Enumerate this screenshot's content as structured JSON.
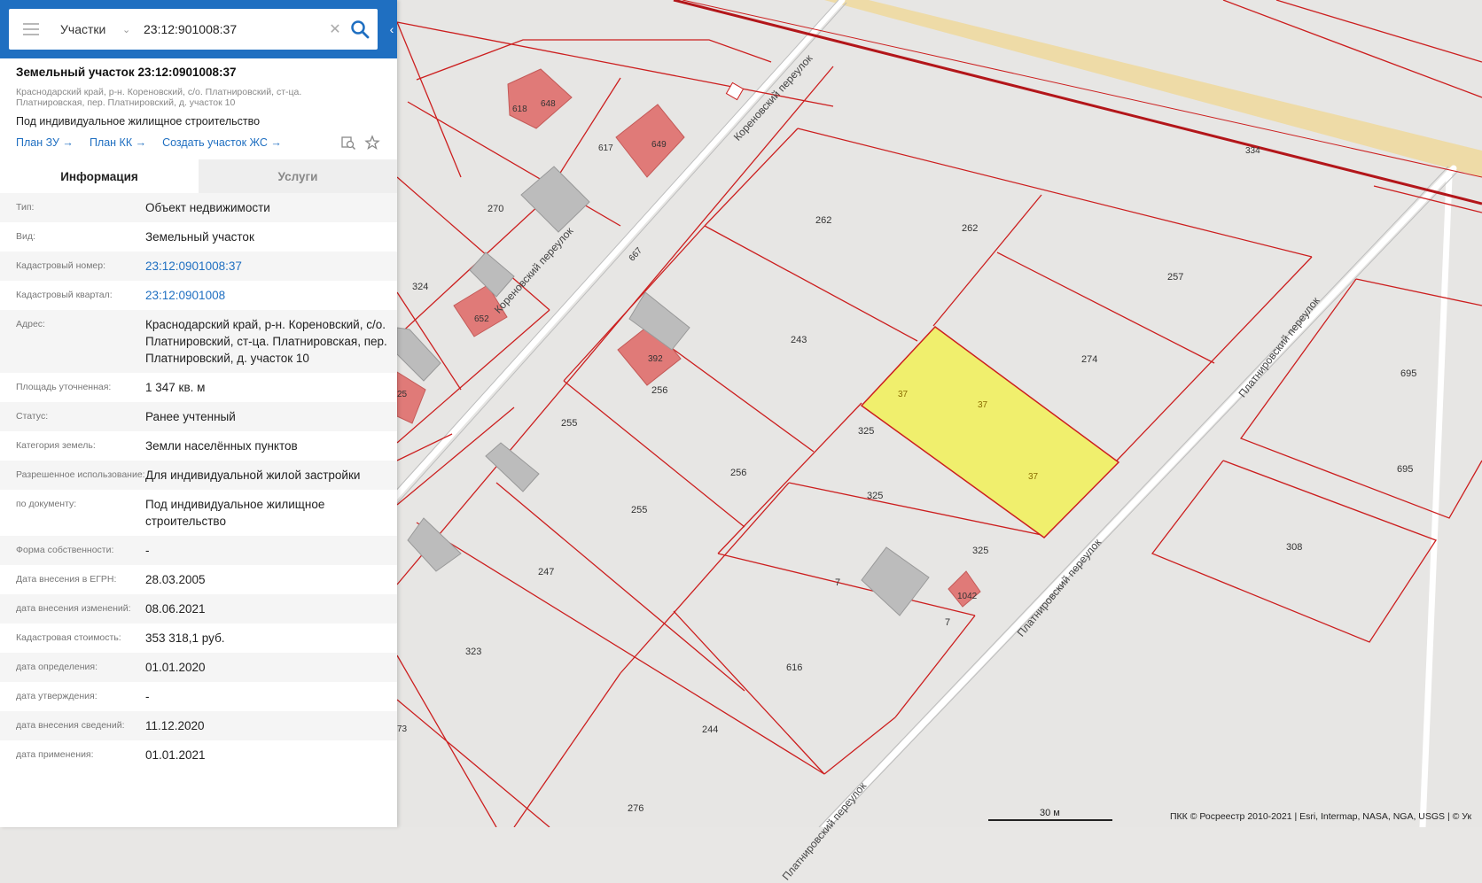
{
  "search": {
    "type_label": "Участки",
    "value": "23:12:901008:37"
  },
  "parcel": {
    "title": "Земельный участок 23:12:0901008:37",
    "address_small": "Краснодарский край, р-н. Кореновский, с/о. Платнировский, ст-ца. Платнировская, пер. Платнировский, д. участок 10",
    "purpose": "Под индивидуальное жилищное строительство",
    "links": [
      "План ЗУ →",
      "План КК →",
      "Создать участок ЖС →"
    ]
  },
  "tabs": {
    "info": "Информация",
    "services": "Услуги"
  },
  "rows": [
    {
      "label": "Тип:",
      "value": "Объект недвижимости"
    },
    {
      "label": "Вид:",
      "value": "Земельный участок"
    },
    {
      "label": "Кадастровый номер:",
      "value": "23:12:0901008:37"
    },
    {
      "label": "Кадастровый квартал:",
      "value": "23:12:0901008"
    },
    {
      "label": "Адрес:",
      "value": "Краснодарский край, р-н. Кореновский, с/о. Платнировский, ст-ца. Платнировская, пер. Платнировский, д. участок 10"
    },
    {
      "label": "Площадь уточненная:",
      "value": "1 347 кв. м"
    },
    {
      "label": "Статус:",
      "value": "Ранее учтенный"
    },
    {
      "label": "Категория земель:",
      "value": "Земли населённых пунктов"
    },
    {
      "label": "Разрешенное использование:",
      "value": "Для индивидуальной жилой застройки"
    },
    {
      "label": "по документу:",
      "value": "Под индивидуальное жилищное строительство"
    },
    {
      "label": "Форма собственности:",
      "value": "-"
    },
    {
      "label": "Дата внесения в ЕГРН:",
      "value": "28.03.2005"
    },
    {
      "label": "дата внесения изменений:",
      "value": "08.06.2021"
    },
    {
      "label": "Кадастровая стоимость:",
      "value": "353 318,1 руб."
    },
    {
      "label": "дата определения:",
      "value": "01.01.2020"
    },
    {
      "label": "дата утверждения:",
      "value": "-"
    },
    {
      "label": "дата внесения сведений:",
      "value": "11.12.2020"
    },
    {
      "label": "дата применения:",
      "value": "01.01.2021"
    }
  ],
  "map": {
    "streets": [
      "Кореновский переулок",
      "Кореновский переулок",
      "Платнировский переулок",
      "Платнировский переулок",
      "Платнировский переулок"
    ],
    "parcel_numbers": [
      "618",
      "648",
      "617",
      "649",
      "270",
      "324",
      "652",
      "392",
      "256",
      "262",
      "262",
      "257",
      "243",
      "274",
      "37",
      "37",
      "37",
      "325",
      "325",
      "325",
      "255",
      "256",
      "255",
      "247",
      "7",
      "7",
      "1042",
      "323",
      "616",
      "244",
      "276",
      "73",
      "25",
      "334",
      "667",
      "695",
      "695",
      "308"
    ],
    "scale": "30 м",
    "attribution": "ПКК © Росреестр 2010-2021 | Esri, Intermap, NASA, NGA, USGS | © Ук",
    "highlight_color": "#f0ef6d",
    "line_color": "#cc1f1f",
    "building_color": "#e07a78"
  }
}
